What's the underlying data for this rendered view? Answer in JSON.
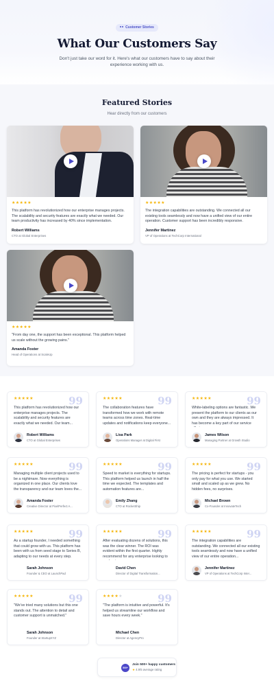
{
  "hero": {
    "badge": "Customer Stories",
    "title": "What Our Customers Say",
    "subtitle": "Don't just take our word for it. Here's what our customers have to say about their experience working with us."
  },
  "featured": {
    "title": "Featured Stories",
    "subtitle": "Hear directly from our customers",
    "cards": [
      {
        "stars": "★★★★★",
        "quote": "This platform has revolutionized how our enterprise manages projects. The scalability and security features are exactly what we needed. Our team productivity has increased by 40% since implementation.",
        "name": "Robert Williams",
        "role": "CTO at Global Enterprises"
      },
      {
        "stars": "★★★★★",
        "quote": "The integration capabilities are outstanding. We connected all our existing tools seamlessly and now have a unified view of our entire operation. Customer support has been incredibly responsive.",
        "name": "Jennifer Martinez",
        "role": "VP of Operations at TechCorp International"
      },
      {
        "stars": "★★★★★",
        "quote": "\"From day one, the support has been exceptional. This platform helped us scale without the growing pains.\"",
        "name": "Amanda Foster",
        "role": "Head of Operations at ScaleUp"
      }
    ]
  },
  "testimonials": [
    {
      "stars": "★★★★★",
      "quote": "This platform has revolutionized how our enterprise manages projects. The scalability and security features are exactly what we needed. Our team...",
      "name": "Robert Williams",
      "role": "CTO at Global Enterprises"
    },
    {
      "stars": "★★★★★",
      "quote": "The collaboration features have transformed how we work with remote teams across time zones. Real-time updates and notifications keep everyone...",
      "name": "Lisa Park",
      "role": "Operations Manager at Digital First"
    },
    {
      "stars": "★★★★★",
      "quote": "White-labeling options are fantastic. We present the platform to our clients as our own and they are always impressed. It has become a key part of our service offering.",
      "name": "James Wilson",
      "role": "Managing Partner at Growth Studio"
    },
    {
      "stars": "★★★★★",
      "quote": "Managing multiple client projects used to be a nightmare. Now everything is organized in one place. Our clients love the transparency and our team loves the...",
      "name": "Amanda Foster",
      "role": "Creative Director at PixelPerfect A..."
    },
    {
      "stars": "★★★★★",
      "quote": "Speed to market is everything for startups. This platform helped us launch in half the time we expected. The templates and automation features are...",
      "name": "Emily Zhang",
      "role": "CTO at RocketShip"
    },
    {
      "stars": "★★★★★",
      "quote": "The pricing is perfect for startups - you only pay for what you use. We started small and scaled up as we grew. No hidden fees, no surprises.",
      "name": "Michael Brown",
      "role": "Co-Founder at InnovateTech"
    },
    {
      "stars": "★★★★★",
      "quote": "As a startup founder, I needed something that could grow with us. This platform has been with us from seed stage to Series B, adapting to our needs at every step.",
      "name": "Sarah Johnson",
      "role": "Founder & CEO at LaunchPad"
    },
    {
      "stars": "★★★★★",
      "quote": "After evaluating dozens of solutions, this was the clear winner. The ROI was evident within the first quarter. Highly recommend for any enterprise looking to modernize...",
      "name": "David Chen",
      "role": "Director of Digital Transformation..."
    },
    {
      "stars": "★★★★★",
      "quote": "The integration capabilities are outstanding. We connected all our existing tools seamlessly and now have a unified view of our entire operation...",
      "name": "Jennifer Martinez",
      "role": "VP of Operations at TechCorp Inter..."
    },
    {
      "stars": "★★★★★",
      "quote": "\"We've tried many solutions but this one stands out. The attention to detail and customer support is unmatched.\"",
      "name": "Sarah Johnson",
      "role": "Founder at StartupXYZ"
    },
    {
      "stars": "★★★★",
      "stars_off": "★",
      "quote": "\"The platform is intuitive and powerful. It's helped us streamline our workflow and save hours every week.\"",
      "name": "Michael Chen",
      "role": "Director at AgencyPro"
    }
  ],
  "footer": {
    "logo_text": "500+",
    "line1": "Join 500+ happy customers",
    "star": "★",
    "rating": "4.9/5 average rating"
  },
  "colors": {
    "accent": "#4b47c8",
    "star": "#f5b50a",
    "quote_mark": "#cfd4f3"
  }
}
